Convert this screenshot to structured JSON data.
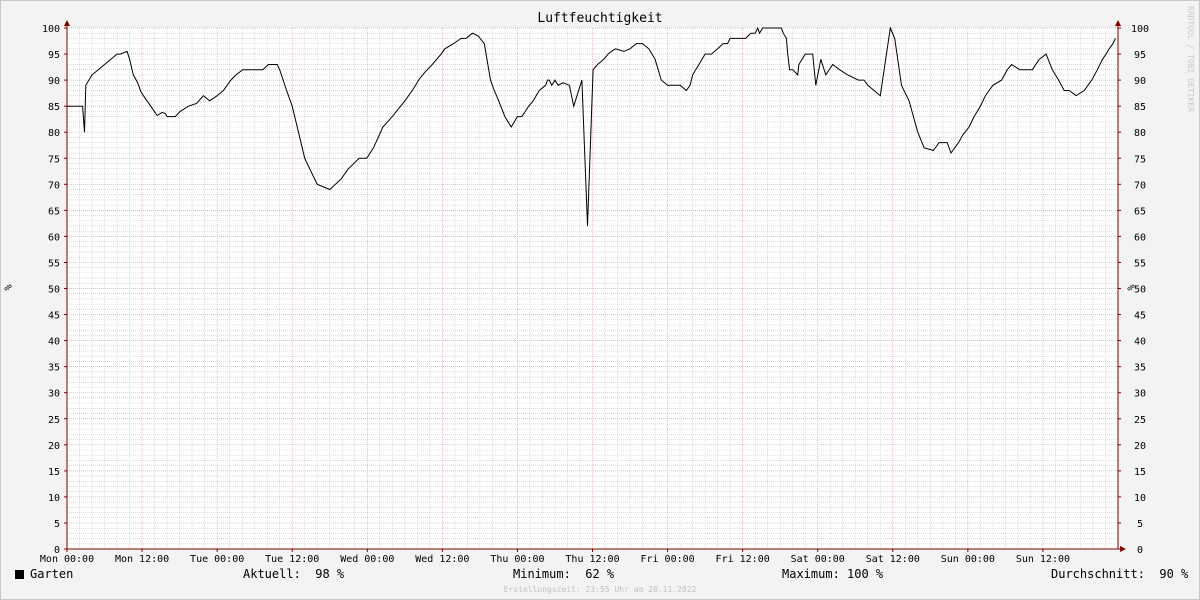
{
  "chart_data": {
    "type": "line",
    "title": "Luftfeuchtigkeit",
    "ylabel": "%",
    "ylim": [
      0,
      100
    ],
    "y_ticks": [
      0,
      5,
      10,
      15,
      20,
      25,
      30,
      35,
      40,
      45,
      50,
      55,
      60,
      65,
      70,
      75,
      80,
      85,
      90,
      95,
      100
    ],
    "x_ticks": [
      "Mon 00:00",
      "Mon 12:00",
      "Tue 00:00",
      "Tue 12:00",
      "Wed 00:00",
      "Wed 12:00",
      "Thu 00:00",
      "Thu 12:00",
      "Fri 00:00",
      "Fri 12:00",
      "Sat 00:00",
      "Sat 12:00",
      "Sun 00:00",
      "Sun 12:00"
    ],
    "xlim_hours": [
      0,
      168
    ],
    "grid": "on",
    "series": [
      {
        "name": "Garten",
        "color": "#000000",
        "x_hours": [
          0,
          2.5,
          2.8,
          3.0,
          3.4,
          4,
          5,
          6,
          7,
          8,
          8.5,
          9.6,
          10,
          10.6,
          11.3,
          11.8,
          12.5,
          13.5,
          14.4,
          15.2,
          15.7,
          16,
          17.3,
          18.1,
          19.4,
          20.7,
          21.8,
          22.8,
          24,
          25,
          26.2,
          27,
          28.1,
          29.6,
          30.2,
          31.3,
          32.2,
          33.6,
          34,
          35.1,
          36,
          37,
          38,
          40,
          42,
          43.8,
          45,
          46.7,
          47.9,
          49,
          50.5,
          52,
          54,
          55.2,
          56.2,
          57.2,
          58.4,
          59.1,
          59.8,
          60.4,
          61.8,
          63,
          63.8,
          64.3,
          64.8,
          65.7,
          66.7,
          67.7,
          68.3,
          69,
          69.5,
          70,
          71,
          72,
          72.7,
          73.8,
          74.5,
          75.5,
          76.5,
          76.8,
          77.1,
          77.5,
          78,
          78.5,
          79.3,
          80.3,
          81,
          82.3,
          83.2,
          84.1,
          84.8,
          85.8,
          86.5,
          87,
          87.7,
          89,
          90,
          91,
          92,
          93,
          94,
          95,
          96,
          97,
          98,
          99,
          99.6,
          100,
          101,
          102,
          103,
          104,
          104.9,
          105.6,
          106,
          106.4,
          107,
          108.5,
          109.3,
          110,
          110.4,
          110.7,
          111.2,
          112.5,
          113.4,
          114.2,
          114.5,
          115,
          115.2,
          115.5,
          116,
          116.8,
          117,
          117.5,
          118,
          118.8,
          119.2,
          119.7,
          120.5,
          121.3,
          122.4,
          123.5,
          124.8,
          126.5,
          127.2,
          127.4,
          128,
          129,
          130,
          131.6,
          132.3,
          133.4,
          134.6,
          135.3,
          136,
          137,
          138.5,
          139.4,
          140.7,
          141.3,
          142.5,
          143.2,
          144.2,
          145,
          146,
          146.8,
          147.4,
          148,
          149.4,
          150.3,
          151,
          152.3,
          153.5,
          154.3,
          155.4,
          156.5,
          157.5,
          158.5,
          159.4,
          160.2,
          161.3,
          162.6,
          163.8,
          164.7,
          165.5,
          166.1,
          166.6,
          167.2,
          167.6
        ],
        "y": [
          85,
          85,
          80,
          89,
          89.8,
          91,
          92,
          93,
          94,
          95,
          95,
          95.5,
          94,
          91,
          89.5,
          87.8,
          86.5,
          84.8,
          83.2,
          83.8,
          83.6,
          83,
          83,
          84,
          85,
          85.5,
          87,
          86,
          87,
          88,
          90,
          91,
          92,
          92,
          92,
          92,
          93,
          93,
          92,
          88,
          85,
          80,
          75,
          70,
          69,
          71,
          73,
          75,
          75,
          77,
          81,
          83,
          86,
          88,
          90,
          91.5,
          93,
          94,
          95,
          96,
          97,
          98,
          98,
          98.5,
          99,
          98.5,
          97,
          90,
          88,
          86,
          84.5,
          83,
          81,
          83,
          83,
          85,
          86,
          88,
          89,
          90,
          90,
          89,
          90,
          89,
          89.5,
          89,
          85,
          90,
          62,
          92,
          93,
          94,
          95,
          95.5,
          96,
          95.5,
          96,
          97,
          97,
          96,
          94,
          90,
          89,
          89,
          89,
          88,
          89,
          91,
          93,
          95,
          95,
          96,
          97,
          97,
          98,
          98,
          98,
          98,
          99,
          99,
          100,
          99,
          100,
          100,
          100,
          100,
          99,
          98,
          95,
          92,
          92,
          91,
          93,
          94,
          95,
          95,
          95,
          89,
          94,
          91,
          93,
          92,
          91,
          90,
          90,
          90,
          89,
          88,
          87,
          100,
          98,
          89,
          86,
          83,
          80,
          77,
          76.5,
          78,
          78,
          76,
          78,
          79.5,
          81,
          83,
          85,
          87,
          88,
          89,
          90,
          92,
          93,
          92,
          92,
          92,
          94,
          95,
          92,
          90,
          88,
          88,
          87,
          88,
          90,
          92,
          94,
          95,
          96,
          97,
          98,
          98
        ],
        "current": 98,
        "minimum": 62,
        "maximum": 100,
        "average": 90
      }
    ]
  },
  "legend": {
    "series_name": "Garten",
    "aktuell_label": "Aktuell:",
    "aktuell_value": "98 %",
    "minimum_label": "Minimum:",
    "minimum_value": "62 %",
    "maximum_label": "Maximum:",
    "maximum_value": "100 %",
    "durchschnitt_label": "Durchschnitt:",
    "durchschnitt_value": "90 %"
  },
  "footer": {
    "creation_note": "Erstellungszeit: 23:55 Uhr am 20.11.2022",
    "watermark": "RRDTOOL / TOBI OETIKER"
  },
  "colors": {
    "background": "#f3f3f3",
    "plot_background": "#ffffff",
    "major_grid": "#e8a0a0",
    "minor_grid": "#c8c8c8",
    "axis": "#800000",
    "line": "#000000"
  }
}
